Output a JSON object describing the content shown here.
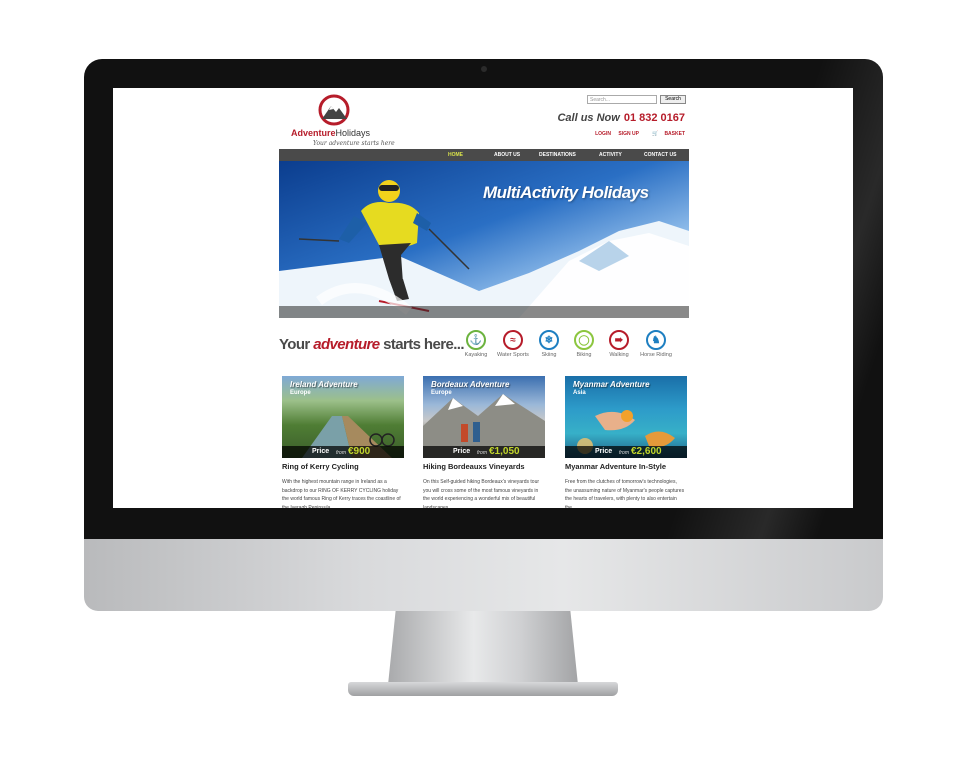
{
  "site": {
    "logo": {
      "name_bold": "Adventure",
      "name_light": "Holidays",
      "tagline": "Your adventure starts here"
    },
    "search": {
      "placeholder": "Search...",
      "button": "Search"
    },
    "call": {
      "label": "Call us Now",
      "number": "01 832 0167"
    },
    "user_links": [
      "LOGIN",
      "SIGN UP",
      "BASKET"
    ],
    "nav": [
      "HOME",
      "ABOUT US",
      "DESTINATIONS",
      "ACTIVITY",
      "CONTACT US"
    ],
    "hero": {
      "title": "MultiActivity Holidays"
    },
    "tagline": {
      "pre": "Your ",
      "em": "adventure",
      "post": " starts here..."
    },
    "activities": [
      {
        "label": "Kayaking",
        "color": "#6cb33f"
      },
      {
        "label": "Water Sports",
        "color": "#b61c2a"
      },
      {
        "label": "Skiing",
        "color": "#1e7fc1"
      },
      {
        "label": "Biking",
        "color": "#8cc63f"
      },
      {
        "label": "Walking",
        "color": "#b61c2a"
      },
      {
        "label": "Horse Riding",
        "color": "#1e7fc1"
      }
    ],
    "cards": [
      {
        "region": "Ireland Adventure",
        "sub": "Europe",
        "price_label": "Price",
        "from": "from",
        "price": "€900",
        "title": "Ring of Kerry Cycling",
        "text": "With the highest mountain range in Ireland as a backdrop to our RING OF KERRY CYCLING holiday the world famous Ring of Kerry traces the coastline of the Iveragh Peninsula"
      },
      {
        "region": "Bordeaux Adventure",
        "sub": "Europe",
        "price_label": "Price",
        "from": "from",
        "price": "€1,050",
        "title": "Hiking Bordeauxs Vineyards",
        "text": "On this Self-guided hiking Bordeaux's vineyards tour you will cross some of the most famous vineyards in the world experiencing a wonderful mix of beautiful landscapes"
      },
      {
        "region": "Myanmar Adventure",
        "sub": "Asia",
        "price_label": "Price",
        "from": "from",
        "price": "€2,600",
        "title": "Myanmar Adventure In-Style",
        "text": "Free from the clutches of tomorrow's technologies, the unassuming nature of Myanmar's people captures the hearts of travelers, with plenty to also entertain the"
      }
    ]
  }
}
